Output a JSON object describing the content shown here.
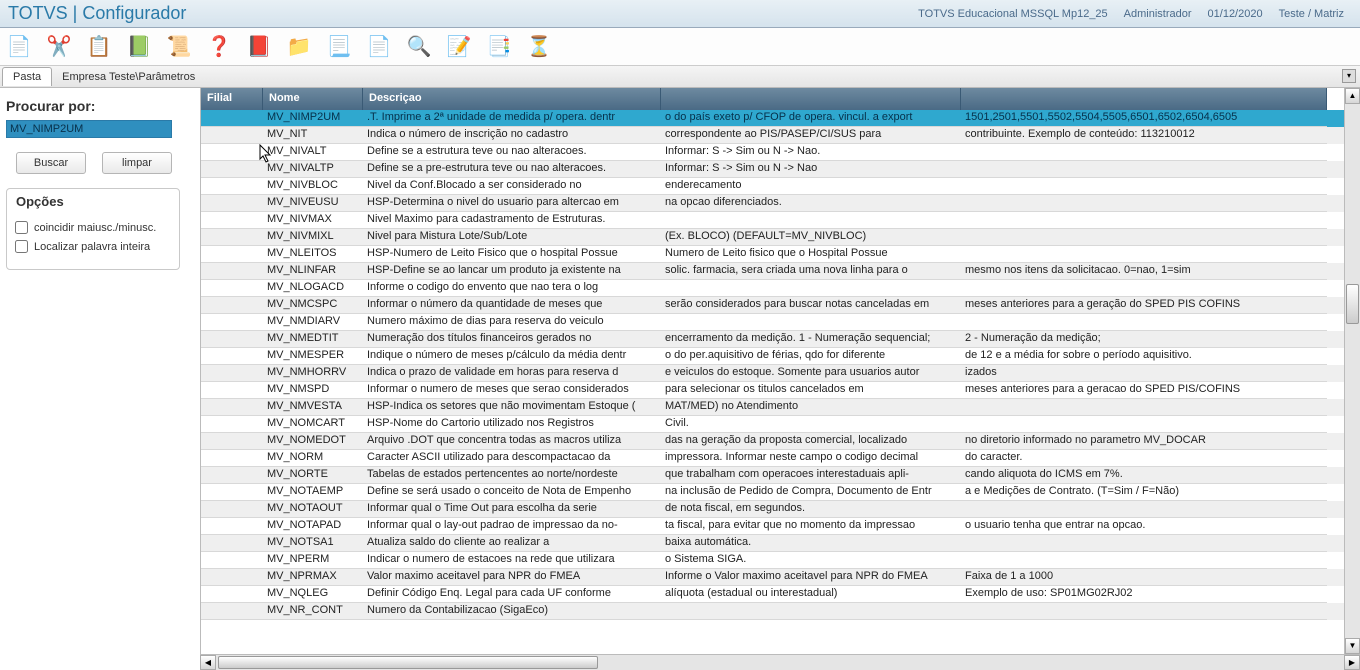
{
  "titlebar": {
    "app": "TOTVS | Configurador",
    "meta1": "TOTVS Educacional MSSQL Mp12_25",
    "meta2": "Administrador",
    "meta3": "01/12/2020",
    "meta4": "Teste / Matriz"
  },
  "toolbar_icons": [
    {
      "name": "new-icon",
      "glyph": "📄"
    },
    {
      "name": "cut-icon",
      "glyph": "✂️"
    },
    {
      "name": "paste-icon",
      "glyph": "📋"
    },
    {
      "name": "book-icon",
      "glyph": "📗"
    },
    {
      "name": "log-icon",
      "glyph": "📜"
    },
    {
      "name": "help-icon",
      "glyph": "❓"
    },
    {
      "name": "exit-icon",
      "glyph": "📕"
    },
    {
      "name": "folder-icon",
      "glyph": "📁"
    },
    {
      "name": "list-icon",
      "glyph": "📃"
    },
    {
      "name": "add-page-icon",
      "glyph": "📄"
    },
    {
      "name": "zoom-page-icon",
      "glyph": "🔍"
    },
    {
      "name": "edit-page-icon",
      "glyph": "📝"
    },
    {
      "name": "pages-icon",
      "glyph": "📑"
    },
    {
      "name": "filter-icon",
      "glyph": "⏳"
    }
  ],
  "breadcrumb": {
    "tab": "Pasta",
    "path": "Empresa Teste\\Parâmetros"
  },
  "search": {
    "label": "Procurar por:",
    "value": "MV_NIMP2UM",
    "buscar": "Buscar",
    "limpar": "limpar",
    "options_title": "Opções",
    "opt1": "coincidir maiusc./minusc.",
    "opt2": "Localizar palavra inteira"
  },
  "columns": [
    "Filial",
    "Nome",
    "Descriçao",
    "",
    ""
  ],
  "rows": [
    {
      "sel": true,
      "c": [
        "",
        "MV_NIMP2UM",
        ".T. Imprime a 2ª unidade de medida p/ opera. dentr",
        "o do país exeto p/ CFOP de opera. vincul. a export",
        "1501,2501,5501,5502,5504,5505,6501,6502,6504,6505"
      ]
    },
    {
      "c": [
        "",
        "MV_NIT",
        "Indica o número de inscrição no cadastro",
        "correspondente ao PIS/PASEP/CI/SUS para",
        "contribuinte. Exemplo de conteúdo: 113210012"
      ]
    },
    {
      "c": [
        "",
        "MV_NIVALT",
        "Define se a estrutura teve ou nao alteracoes.",
        "Informar: S -> Sim ou N -> Nao.",
        ""
      ]
    },
    {
      "c": [
        "",
        "MV_NIVALTP",
        "Define se a pre-estrutura teve ou nao alteracoes.",
        "Informar: S -> Sim ou N -> Nao",
        ""
      ]
    },
    {
      "c": [
        "",
        "MV_NIVBLOC",
        "Nivel da Conf.Blocado a ser considerado no",
        "enderecamento",
        ""
      ]
    },
    {
      "c": [
        "",
        "MV_NIVEUSU",
        "HSP-Determina o nivel do usuario para altercao em",
        "na opcao diferenciados.",
        ""
      ]
    },
    {
      "c": [
        "",
        "MV_NIVMAX",
        "Nivel Maximo para cadastramento de Estruturas.",
        "",
        ""
      ]
    },
    {
      "c": [
        "",
        "MV_NIVMIXL",
        "Nivel para Mistura Lote/Sub/Lote",
        "(Ex. BLOCO) (DEFAULT=MV_NIVBLOC)",
        ""
      ]
    },
    {
      "c": [
        "",
        "MV_NLEITOS",
        "HSP-Numero de Leito Fisico que o hospital Possue",
        "Numero de Leito fisico que o Hospital Possue",
        ""
      ]
    },
    {
      "c": [
        "",
        "MV_NLINFAR",
        "HSP-Define se ao lancar um produto ja existente na",
        "solic. farmacia, sera criada uma nova linha para o",
        "mesmo nos itens da solicitacao. 0=nao, 1=sim"
      ]
    },
    {
      "c": [
        "",
        "MV_NLOGACD",
        "Informe  o codigo do envento que nao tera o log",
        "",
        ""
      ]
    },
    {
      "c": [
        "",
        "MV_NMCSPC",
        "Informar o número da quantidade de meses que",
        "serão considerados para buscar notas canceladas em",
        "meses anteriores para a geração do SPED PIS COFINS"
      ]
    },
    {
      "c": [
        "",
        "MV_NMDIARV",
        "Numero máximo de dias para reserva do veiculo",
        "",
        ""
      ]
    },
    {
      "c": [
        "",
        "MV_NMEDTIT",
        "Numeração dos títulos financeiros gerados no",
        "encerramento da medição. 1 - Numeração sequencial;",
        "2 - Numeração da medição;"
      ]
    },
    {
      "c": [
        "",
        "MV_NMESPER",
        "Indique o número de meses p/cálculo da média dentr",
        "o do per.aquisitivo de férias, qdo for diferente",
        "de 12 e a média for sobre o período aquisitivo."
      ]
    },
    {
      "c": [
        "",
        "MV_NMHORRV",
        "Indica o prazo de validade em horas para reserva d",
        "e veiculos do estoque. Somente para usuarios autor",
        "izados"
      ]
    },
    {
      "c": [
        "",
        "MV_NMSPD",
        "Informar o numero de meses que serao considerados",
        "para selecionar os titulos cancelados em",
        "meses anteriores para a geracao do SPED PIS/COFINS"
      ]
    },
    {
      "c": [
        "",
        "MV_NMVESTA",
        "HSP-Indica os setores que não movimentam Estoque (",
        "MAT/MED) no Atendimento",
        ""
      ]
    },
    {
      "c": [
        "",
        "MV_NOMCART",
        "HSP-Nome do Cartorio utilizado nos Registros",
        "Civil.",
        ""
      ]
    },
    {
      "c": [
        "",
        "MV_NOMEDOT",
        "Arquivo .DOT que concentra todas as macros utiliza",
        "das na geração da proposta comercial, localizado",
        "no diretorio informado no parametro MV_DOCAR"
      ]
    },
    {
      "c": [
        "",
        "MV_NORM",
        "Caracter ASCII utilizado  para  descompactacao  da",
        "impressora.  Informar neste campo o codigo decimal",
        "do caracter."
      ]
    },
    {
      "c": [
        "",
        "MV_NORTE",
        "Tabelas de estados pertencentes ao norte/nordeste",
        "que trabalham com operacoes  interestaduais  apli-",
        "cando aliquota do ICMS em 7%."
      ]
    },
    {
      "c": [
        "",
        "MV_NOTAEMP",
        "Define se será usado o conceito de Nota de Empenho",
        "na inclusão de Pedido de Compra, Documento de Entr",
        "a e Medições de Contrato. (T=Sim / F=Não)"
      ]
    },
    {
      "c": [
        "",
        "MV_NOTAOUT",
        "Informar qual o Time Out para escolha da serie",
        "de nota fiscal, em segundos.",
        ""
      ]
    },
    {
      "c": [
        "",
        "MV_NOTAPAD",
        "Informar qual o lay-out padrao de impressao da no-",
        "ta fiscal, para evitar que no momento da impressao",
        "o usuario tenha que entrar na opcao."
      ]
    },
    {
      "c": [
        "",
        "MV_NOTSA1",
        "Atualiza saldo do cliente ao realizar a",
        "baixa automática.",
        ""
      ]
    },
    {
      "c": [
        "",
        "MV_NPERM",
        "Indicar o numero de estacoes na rede que utilizara",
        "o Sistema SIGA.",
        ""
      ]
    },
    {
      "c": [
        "",
        "MV_NPRMAX",
        "Valor maximo aceitavel para NPR do FMEA",
        "Informe o Valor maximo aceitavel para NPR do FMEA",
        "Faixa de 1 a 1000"
      ]
    },
    {
      "c": [
        "",
        "MV_NQLEG",
        "Definir Código Enq. Legal para cada UF conforme",
        "alíquota (estadual ou interestadual)",
        "Exemplo de uso: SP01MG02RJ02"
      ]
    },
    {
      "c": [
        "",
        "MV_NR_CONT",
        "Numero da Contabilizacao (SigaEco)",
        "",
        ""
      ]
    }
  ]
}
